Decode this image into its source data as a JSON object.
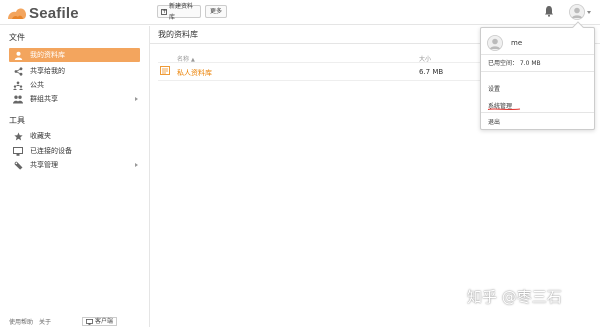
{
  "header": {
    "logo_text": "Seafile",
    "new_library_label": "新建资料库",
    "more_label": "更多",
    "brand_color": "#f3a55e"
  },
  "sidebar": {
    "files_title": "文件",
    "files_items": [
      {
        "label": "我的资料库",
        "icon": "user-icon",
        "active": true
      },
      {
        "label": "共享给我的",
        "icon": "share-icon",
        "active": false
      },
      {
        "label": "公共",
        "icon": "public-icon",
        "active": false
      },
      {
        "label": "群组共享",
        "icon": "group-icon",
        "active": false,
        "has_arrow": true
      }
    ],
    "tools_title": "工具",
    "tools_items": [
      {
        "label": "收藏夹",
        "icon": "star-icon"
      },
      {
        "label": "已连接的设备",
        "icon": "monitor-icon"
      },
      {
        "label": "共享管理",
        "icon": "wrench-icon",
        "has_arrow": true
      }
    ],
    "footer": {
      "help": "使用帮助",
      "about": "关于",
      "client": "客户端"
    }
  },
  "main": {
    "title": "我的资料库",
    "columns": {
      "name": "名称",
      "size": "大小"
    },
    "rows": [
      {
        "name": "私人资料库",
        "size": "6.7 MB"
      }
    ]
  },
  "dropdown": {
    "username": "me",
    "used_space": "已用空间： 7.0 MB",
    "settings": "设置",
    "sys_admin": "系统管理",
    "logout": "退出",
    "underline_color": "#e0302a"
  },
  "watermark": {
    "text": "知乎 @枣三石"
  }
}
